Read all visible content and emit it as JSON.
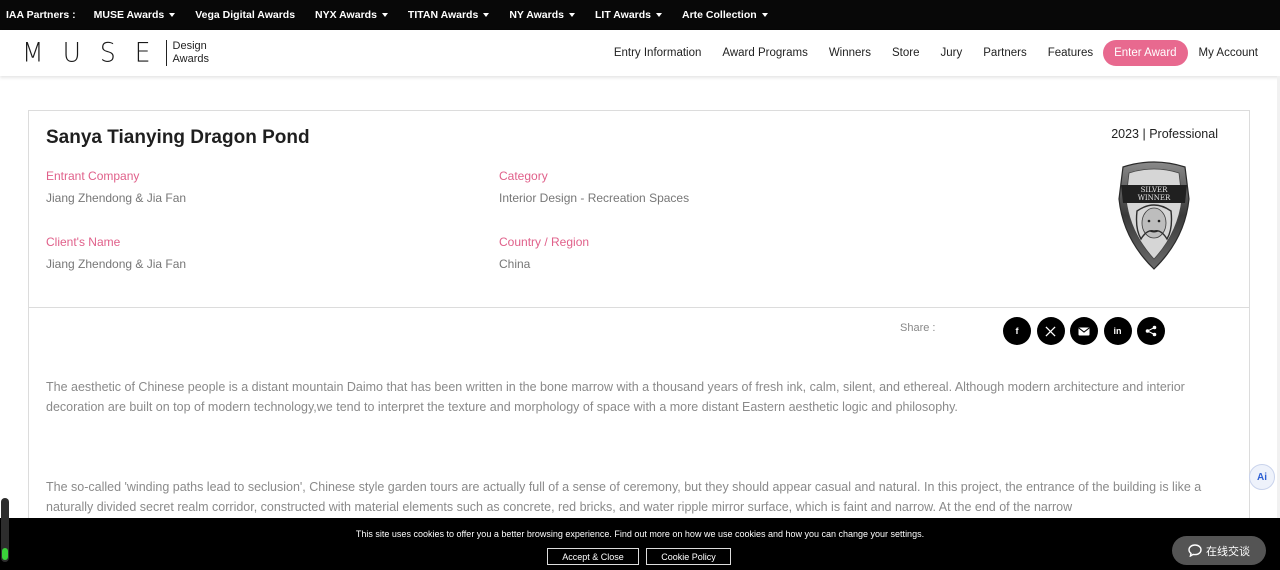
{
  "partner_bar": {
    "label": "IAA Partners :",
    "items": [
      {
        "label": "MUSE Awards",
        "dropdown": true
      },
      {
        "label": "Vega Digital Awards",
        "dropdown": false
      },
      {
        "label": "NYX Awards",
        "dropdown": true
      },
      {
        "label": "TITAN Awards",
        "dropdown": true
      },
      {
        "label": "NY Awards",
        "dropdown": true
      },
      {
        "label": "LIT Awards",
        "dropdown": true
      },
      {
        "label": "Arte Collection",
        "dropdown": true
      }
    ]
  },
  "header": {
    "logo_word": "MUSE",
    "logo_sub_1": "Design",
    "logo_sub_2": "Awards",
    "nav": [
      "Entry Information",
      "Award Programs",
      "Winners",
      "Store",
      "Jury",
      "Partners",
      "Features"
    ],
    "enter_award": "Enter Award",
    "my_account": "My Account"
  },
  "project": {
    "title": "Sanya Tianying Dragon Pond",
    "year_type": "2023 | Professional",
    "entrant_company_label": "Entrant Company",
    "entrant_company": "Jiang Zhendong & Jia Fan",
    "category_label": "Category",
    "category": "Interior Design - Recreation Spaces",
    "client_label": "Client's Name",
    "client": "Jiang Zhendong & Jia Fan",
    "country_label": "Country / Region",
    "country": "China",
    "badge_line1": "SILVER",
    "badge_line2": "WINNER"
  },
  "share": {
    "label": "Share :",
    "icons": [
      "facebook-icon",
      "x-icon",
      "email-icon",
      "linkedin-icon",
      "share-icon"
    ],
    "facebook_glyph": "f",
    "linkedin_glyph": "in"
  },
  "description": {
    "para1": "The aesthetic of Chinese people is a distant mountain Daimo that has been written in the bone marrow with a thousand years of fresh ink, calm, silent, and ethereal. Although modern architecture and interior decoration are built on top of modern technology,we tend to interpret the texture and morphology of space with a more distant Eastern aesthetic logic and philosophy.",
    "para2": "The so-called 'winding paths lead to seclusion', Chinese style garden tours are actually full of a sense of ceremony, but they should appear casual and natural. In this project, the entrance of the building is like a naturally divided secret realm corridor, constructed with material elements such as concrete, red bricks, and water ripple mirror surface, which is faint and narrow. At the end of the narrow"
  },
  "cookie": {
    "text": "This site uses cookies to offer you a better browsing experience. Find out more on how we use cookies and how you can change your settings.",
    "accept": "Accept & Close",
    "policy": "Cookie Policy"
  },
  "chat": {
    "label": "在线交谈"
  },
  "ai": {
    "label": "Ai"
  },
  "colors": {
    "accent_pink": "#e8698f",
    "label_pink": "#e0608a",
    "bar_black": "#080808"
  }
}
